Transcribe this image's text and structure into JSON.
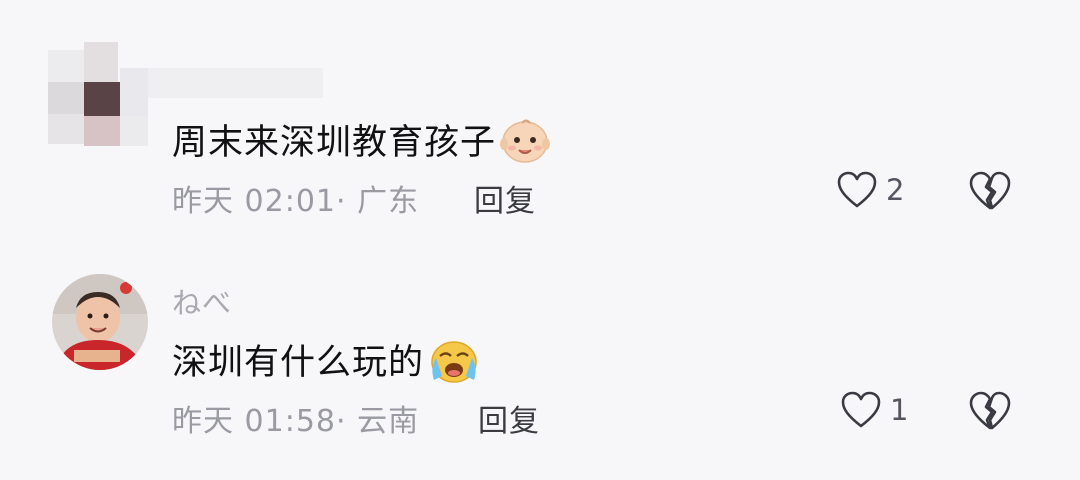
{
  "comments": [
    {
      "username": "",
      "text": "周末来深圳教育孩子",
      "emoji": "baby-face",
      "time": "昨天 02:01",
      "location": "广东",
      "reply_label": "回复",
      "likes": "2"
    },
    {
      "username": "ねべ",
      "text": "深圳有什么玩的",
      "emoji": "crying-face",
      "time": "昨天 01:58",
      "location": "云南",
      "reply_label": "回复",
      "likes": "1"
    }
  ],
  "separator": "· ",
  "colors": {
    "background": "#f7f7f9",
    "text": "#111114",
    "meta": "#9a9aa3",
    "reply": "#3b3b42",
    "icon_stroke": "#3a3a42"
  }
}
